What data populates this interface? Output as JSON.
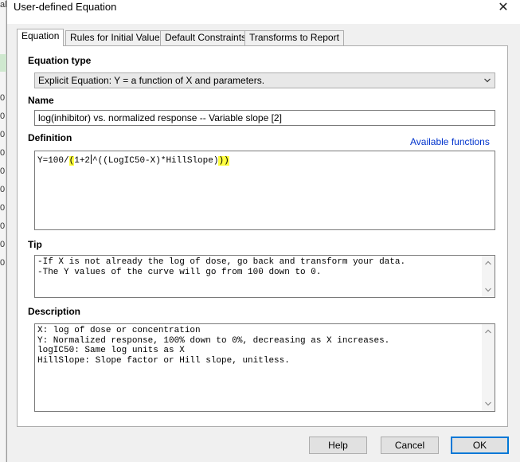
{
  "background": {
    "cutoff_text": "al",
    "row_marks": [
      "0",
      "0",
      "0",
      "0",
      "0",
      "0",
      "0",
      "0",
      "0",
      "0"
    ]
  },
  "window": {
    "title": "User-defined Equation",
    "close_glyph": "✕"
  },
  "tabs": [
    {
      "label": "Equation",
      "active": true
    },
    {
      "label": "Rules for Initial Values",
      "active": false
    },
    {
      "label": "Default Constraints",
      "active": false
    },
    {
      "label": "Transforms to Report",
      "active": false
    }
  ],
  "equation_type": {
    "label": "Equation type",
    "value": "Explicit Equation: Y = a function of X and parameters."
  },
  "name": {
    "label": "Name",
    "value": "log(inhibitor) vs. normalized response -- Variable slope [2]"
  },
  "definition": {
    "label": "Definition",
    "link": "Available functions",
    "parts": {
      "p1": "Y=100/",
      "p2": "(",
      "p3": "1+2",
      "p4": "^((LogIC50-X)*HillSlope)",
      "p5": ")",
      "p6": ")"
    }
  },
  "tip": {
    "label": "Tip",
    "lines": [
      "-If X is not already the log of dose, go back and transform your data.",
      "-The Y values of the curve will go from 100 down to 0."
    ]
  },
  "description": {
    "label": "Description",
    "lines": [
      "X: log of dose or concentration",
      "Y: Normalized response, 100% down to 0%, decreasing as X increases.",
      "logIC50: Same log units as X",
      "HillSlope: Slope factor or Hill slope, unitless."
    ]
  },
  "buttons": {
    "help": "Help",
    "cancel": "Cancel",
    "ok": "OK"
  },
  "colors": {
    "accent": "#0078d7",
    "highlight": "#ffff40",
    "link": "#0033cc"
  }
}
